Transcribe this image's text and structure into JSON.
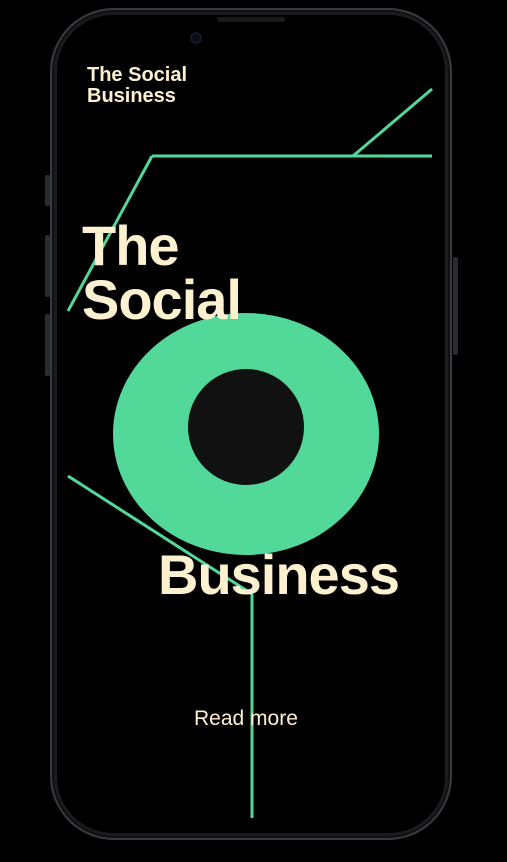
{
  "header": {
    "brand_line1": "The Social",
    "brand_line2": "Business"
  },
  "hero": {
    "line1": "The",
    "line2": "Social",
    "line3": "Business"
  },
  "cta": {
    "read_more_label": "Read more"
  },
  "colors": {
    "background": "#000000",
    "accent_green": "#52d899",
    "cream_text": "#fdf1cf",
    "ring_center": "#111111",
    "frame": "#1b1c1e"
  }
}
